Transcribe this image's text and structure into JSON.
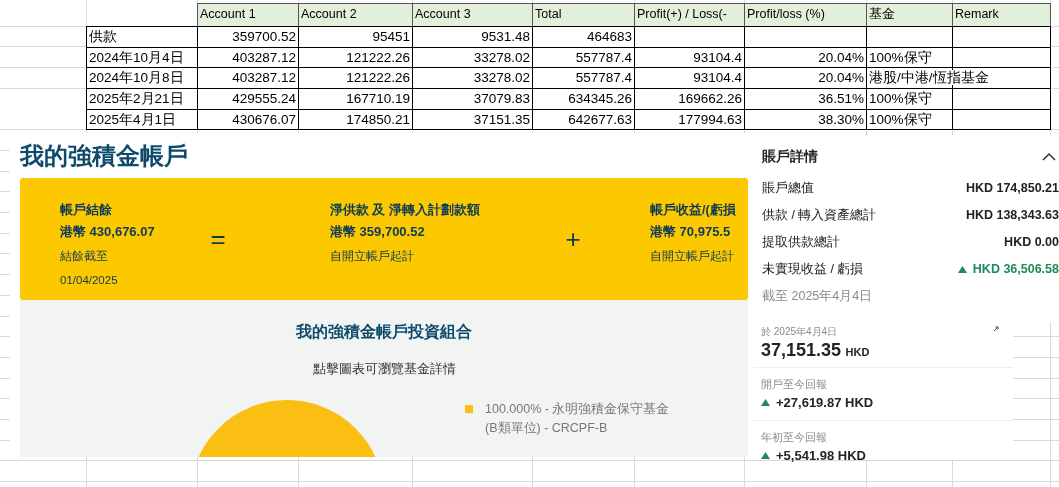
{
  "spreadsheet": {
    "columns": [
      "Account 1",
      "Account 2",
      "Account 3",
      "Total",
      "Profit(+) / Loss(-",
      "Profit/loss (%)",
      "基金",
      "Remark"
    ],
    "rows": [
      {
        "label": "供款",
        "values": [
          "359700.52",
          "95451",
          "9531.48",
          "464683"
        ]
      },
      {
        "label": "2024年10月4日",
        "values": [
          "403287.12",
          "121222.26",
          "33278.02",
          "557787.4",
          "93104.4",
          "20.04%"
        ],
        "fund": "100%保守"
      },
      {
        "label": "2024年10月8日",
        "values": [
          "403287.12",
          "121222.26",
          "33278.02",
          "557787.4",
          "93104.4",
          "20.04%"
        ],
        "fund": "港股/中港/恆指基金"
      },
      {
        "label": "2025年2月21日",
        "values": [
          "429555.24",
          "167710.19",
          "37079.83",
          "634345.26",
          "169662.26",
          "36.51%"
        ],
        "fund": "100%保守"
      },
      {
        "label": "2025年4月1日",
        "values": [
          "430676.07",
          "174850.21",
          "37151.35",
          "642677.63",
          "177994.63",
          "38.30%"
        ],
        "fund": "100%保守"
      }
    ]
  },
  "mpf_page": {
    "title": "我的強積金帳戶",
    "summary": [
      {
        "label": "帳戶結餘",
        "amount": "港幣 430,676.07",
        "note": "結餘截至",
        "date": "01/04/2025"
      },
      {
        "label": "淨供款 及 淨轉入計劃款額",
        "amount": "港幣 359,700.52",
        "note": "自開立帳戶起計"
      },
      {
        "label": "帳戶收益/(虧損",
        "amount": "港幣 70,975.5",
        "note": "自開立帳戶起計"
      }
    ],
    "operators": [
      "=",
      "+"
    ],
    "portfolio": {
      "title": "我的強積金帳戶投資組合",
      "hint": "點擊圖表可瀏覽基金詳情",
      "legend": [
        "100.000% - 永明強積金保守基金 (B類單位) - CRCPF-B"
      ]
    }
  },
  "account_details": {
    "title": "賬戶詳情",
    "expanded": true,
    "rows": [
      {
        "label": "賬戶總值",
        "value": "HKD 174,850.21",
        "kind": "plain"
      },
      {
        "label": "供款 / 轉入資產總計",
        "value": "HKD 138,343.63",
        "kind": "plain"
      },
      {
        "label": "提取供款總計",
        "value": "HKD 0.00",
        "kind": "plain"
      },
      {
        "label": "未實現收益 / 虧損",
        "value": "HKD 36,506.58",
        "kind": "gain"
      }
    ],
    "as_of": "截至 2025年4月4日"
  },
  "fund_card": {
    "date": "於 2025年4月4日",
    "value": "37,151.35",
    "currency": "HKD",
    "returns": [
      {
        "label": "開戶至今回報",
        "value": "+27,619.87 HKD",
        "kind": "gain"
      },
      {
        "label": "年初至今回報",
        "value": "+5,541.98 HKD",
        "kind": "gain"
      }
    ]
  }
}
